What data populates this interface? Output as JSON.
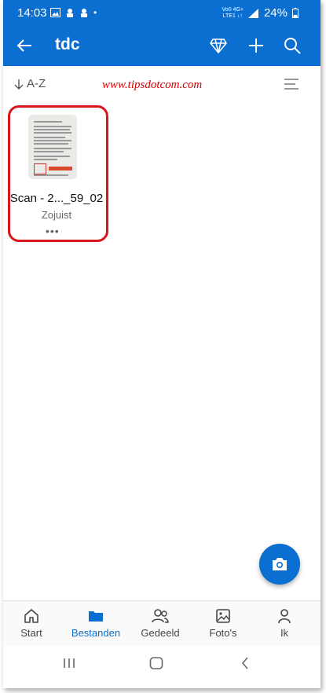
{
  "status_bar": {
    "time": "14:03",
    "network_top": "Vo0 4G+",
    "network_bottom": "LTE1 ↓↑",
    "battery": "24%"
  },
  "app_bar": {
    "title": "tdc"
  },
  "sort": {
    "label": "A-Z"
  },
  "watermark": "www.tipsdotcom.com",
  "file": {
    "name": "Scan - 2..._59_02",
    "modified": "Zojuist",
    "more": "•••"
  },
  "bottom_nav": {
    "items": [
      {
        "label": "Start",
        "icon": "home-icon"
      },
      {
        "label": "Bestanden",
        "icon": "folder-icon"
      },
      {
        "label": "Gedeeld",
        "icon": "people-icon"
      },
      {
        "label": "Foto's",
        "icon": "photo-icon"
      },
      {
        "label": "Ik",
        "icon": "person-icon"
      }
    ],
    "active_index": 1
  },
  "colors": {
    "accent": "#0a6fd0",
    "highlight": "#d8161c",
    "watermark": "#d40000"
  }
}
